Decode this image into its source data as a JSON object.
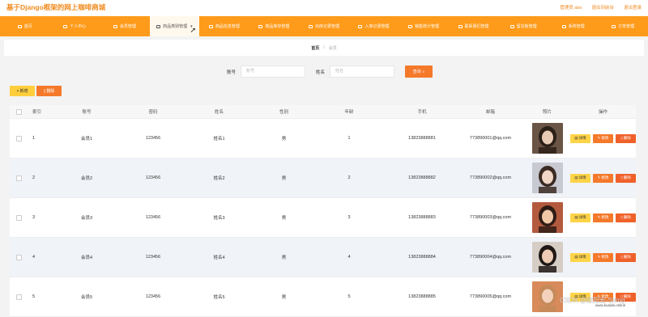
{
  "app": {
    "title": "基于Django框架的网上咖啡商城"
  },
  "topbar": {
    "admin": "管理员 abo",
    "back_home": "退出到前台",
    "logout": "退出登录"
  },
  "nav": [
    {
      "label": "首页",
      "icon": "home-icon"
    },
    {
      "label": "个人中心",
      "icon": "user-icon"
    },
    {
      "label": "会员管理",
      "icon": "member-icon"
    },
    {
      "label": "商品类别管理",
      "icon": "category-icon",
      "active": true,
      "has_chevron": true
    },
    {
      "label": "商品信息管理",
      "icon": "product-icon"
    },
    {
      "label": "商品库存管理",
      "icon": "stock-icon"
    },
    {
      "label": "出库记录管理",
      "icon": "outbound-icon"
    },
    {
      "label": "入库记录管理",
      "icon": "inbound-icon"
    },
    {
      "label": "销售统计管理",
      "icon": "chart-icon"
    },
    {
      "label": "联系我们管理",
      "icon": "contact-icon"
    },
    {
      "label": "留言板管理",
      "icon": "message-icon"
    },
    {
      "label": "系统管理",
      "icon": "system-icon"
    },
    {
      "label": "订单管理",
      "icon": "order-icon"
    }
  ],
  "breadcrumb": {
    "home": "首页",
    "separator": "/",
    "current": "会员"
  },
  "search": {
    "account_label": "账号",
    "account_placeholder": "账号",
    "name_label": "姓名",
    "name_placeholder": "姓名",
    "query_label": "查询"
  },
  "actions": {
    "add": "新增",
    "delete": "删除"
  },
  "table": {
    "headers": [
      "",
      "索引",
      "账号",
      "密码",
      "姓名",
      "性别",
      "年龄",
      "手机",
      "邮箱",
      "照片",
      "操作"
    ],
    "rows": [
      {
        "index": "1",
        "account": "会员1",
        "password": "123456",
        "name": "姓名1",
        "gender": "男",
        "age": "1",
        "phone": "13823888881",
        "email": "773890001@qq.com"
      },
      {
        "index": "2",
        "account": "会员2",
        "password": "123456",
        "name": "姓名2",
        "gender": "男",
        "age": "2",
        "phone": "13823888882",
        "email": "773890002@qq.com"
      },
      {
        "index": "3",
        "account": "会员3",
        "password": "123456",
        "name": "姓名3",
        "gender": "男",
        "age": "3",
        "phone": "13823888883",
        "email": "773890003@qq.com"
      },
      {
        "index": "4",
        "account": "会员4",
        "password": "123456",
        "name": "姓名4",
        "gender": "男",
        "age": "4",
        "phone": "13823888884",
        "email": "773890004@qq.com"
      },
      {
        "index": "5",
        "account": "会员5",
        "password": "123456",
        "name": "姓名5",
        "gender": "男",
        "age": "5",
        "phone": "13823888885",
        "email": "773890005@qq.com"
      }
    ],
    "ops": {
      "detail": "详情",
      "edit": "修改",
      "delete": "删除"
    }
  },
  "watermark": "CSDN @欧阳宏-String",
  "watermark2": "www.kuaida.online",
  "colors": {
    "brand": "#ff9b1a",
    "accent": "#f5792a",
    "yellow": "#ffd447"
  }
}
